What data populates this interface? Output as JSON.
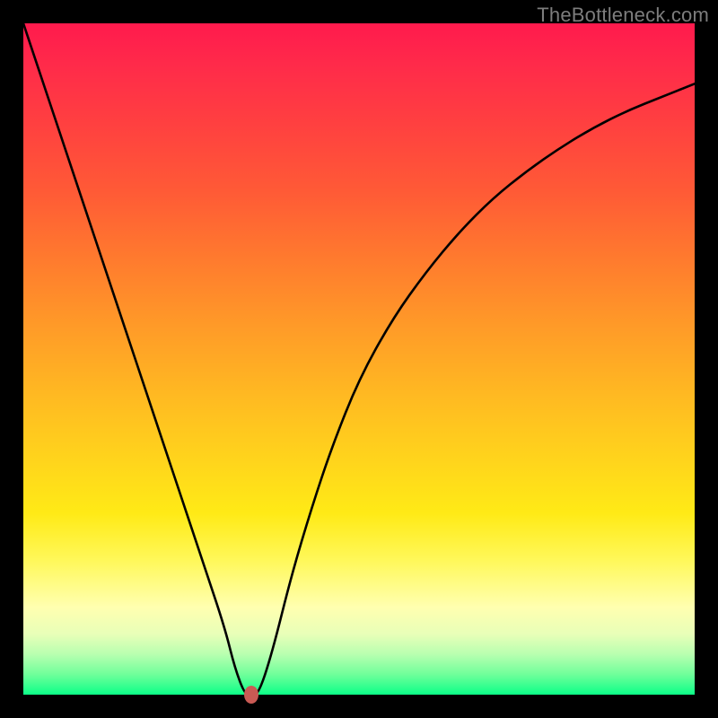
{
  "watermark": "TheBottleneck.com",
  "chart_data": {
    "type": "line",
    "title": "",
    "xlabel": "",
    "ylabel": "",
    "xlim": [
      0,
      100
    ],
    "ylim": [
      0,
      100
    ],
    "grid": false,
    "legend": false,
    "series": [
      {
        "name": "curve",
        "x": [
          0,
          3,
          6,
          9,
          12,
          15,
          18,
          21,
          24,
          27,
          30,
          31.5,
          33,
          34,
          35,
          37,
          40,
          43,
          46,
          50,
          55,
          60,
          65,
          70,
          75,
          80,
          85,
          90,
          95,
          100
        ],
        "y": [
          100,
          91,
          82,
          73,
          64,
          55,
          46,
          37,
          28,
          19,
          10,
          4,
          0,
          0,
          0,
          6,
          18,
          28,
          37,
          47,
          56,
          63,
          69,
          74,
          78,
          81.5,
          84.5,
          87,
          89,
          91
        ]
      }
    ],
    "marker": {
      "x": 34,
      "y": 0,
      "color": "#c95a54"
    },
    "background_gradient": {
      "top": "#ff1a4d",
      "mid": "#ffd41c",
      "bottom": "#0cff88"
    },
    "frame_color": "#000000"
  }
}
